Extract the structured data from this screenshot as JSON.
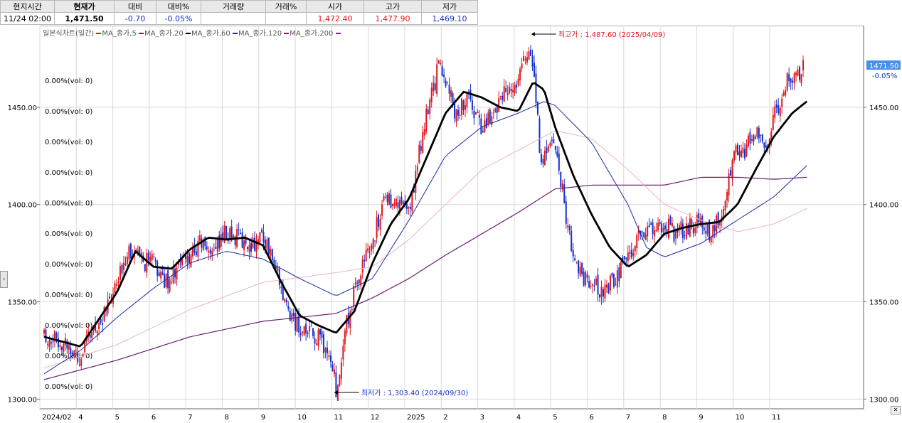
{
  "quote": {
    "headers": [
      "현지시간",
      "현재가",
      "대비",
      "대비%",
      "거래량",
      "거래%",
      "시가",
      "고가",
      "저가"
    ],
    "values": [
      "11/24  02:00",
      "1,471.50",
      "-0.70",
      "-0.05%",
      "",
      "",
      "1,472.40",
      "1,477.90",
      "1,469.10"
    ]
  },
  "chart_title": "일본식차트(일간)",
  "legend": [
    "MA_종가,5",
    "MA_종가,20",
    "MA_종가,60",
    "MA_종가,120",
    "MA_종가,200"
  ],
  "legend_colors": [
    "#e0161b",
    "#b01030",
    "#000000",
    "#1a2aa0",
    "#7a1f78"
  ],
  "current_price_box": {
    "value": "1471.50",
    "pct": "-0.05%"
  },
  "max_label": "최고가 : 1,487.60 (2025/04/09)",
  "min_label": "최저가 : 1,303.40 (2024/09/30)",
  "chart_data": {
    "type": "candlestick",
    "title": "일본식차트(일간)",
    "ylim": [
      1295,
      1492
    ],
    "y_ticks": [
      "1300.00",
      "1350.00",
      "1400.00",
      "1450.00"
    ],
    "y_tick_values": [
      1300,
      1350,
      1400,
      1450
    ],
    "x_labels": [
      "2024/02",
      "4",
      "5",
      "6",
      "7",
      "8",
      "9",
      "10",
      "11",
      "12",
      "2025",
      "2",
      "3",
      "4",
      "5",
      "6",
      "7",
      "8",
      "9",
      "10",
      "11"
    ],
    "volume_labels": [
      "0.00%(vol: 0)",
      "0.00%(vol: 0)",
      "0.00%(vol: 0)",
      "0.00%(vol: 0)",
      "0.00%(vol: 0)",
      "0.00%(vol: 0)",
      "0.00%(vol: 0)",
      "0.00%(vol: 0)",
      "0.00%(vol: 0)",
      "0.00%(vol: 0)",
      "0.00%(vol: 0)"
    ],
    "close_anchors": [
      [
        0,
        1333
      ],
      [
        0.5,
        1330
      ],
      [
        1,
        1321
      ],
      [
        1.3,
        1334
      ],
      [
        1.7,
        1345
      ],
      [
        2,
        1358
      ],
      [
        2.3,
        1379
      ],
      [
        2.6,
        1371
      ],
      [
        3,
        1370
      ],
      [
        3.3,
        1360
      ],
      [
        3.6,
        1366
      ],
      [
        4,
        1374
      ],
      [
        4.3,
        1380
      ],
      [
        4.6,
        1376
      ],
      [
        5,
        1386
      ],
      [
        5.3,
        1383
      ],
      [
        5.6,
        1379
      ],
      [
        6,
        1384
      ],
      [
        6.3,
        1372
      ],
      [
        6.6,
        1348
      ],
      [
        7,
        1336
      ],
      [
        7.3,
        1333
      ],
      [
        7.6,
        1330
      ],
      [
        7.9,
        1318
      ],
      [
        8,
        1305
      ],
      [
        8.3,
        1340
      ],
      [
        8.6,
        1362
      ],
      [
        8.9,
        1375
      ],
      [
        9.1,
        1388
      ],
      [
        9.4,
        1405
      ],
      [
        10,
        1395
      ],
      [
        10.3,
        1430
      ],
      [
        10.6,
        1455
      ],
      [
        10.8,
        1470
      ],
      [
        11,
        1465
      ],
      [
        11.3,
        1445
      ],
      [
        11.6,
        1455
      ],
      [
        12,
        1440
      ],
      [
        12.3,
        1447
      ],
      [
        12.6,
        1458
      ],
      [
        13,
        1466
      ],
      [
        13.3,
        1482
      ],
      [
        13.4,
        1470
      ],
      [
        13.6,
        1425
      ],
      [
        14,
        1430
      ],
      [
        14.3,
        1395
      ],
      [
        14.6,
        1365
      ],
      [
        15,
        1358
      ],
      [
        15.3,
        1356
      ],
      [
        15.6,
        1360
      ],
      [
        16,
        1372
      ],
      [
        16.3,
        1385
      ],
      [
        16.6,
        1388
      ],
      [
        17,
        1390
      ],
      [
        17.3,
        1385
      ],
      [
        17.6,
        1388
      ],
      [
        18,
        1392
      ],
      [
        18.3,
        1384
      ],
      [
        18.6,
        1400
      ],
      [
        18.9,
        1428
      ],
      [
        19.2,
        1426
      ],
      [
        19.5,
        1440
      ],
      [
        19.8,
        1430
      ],
      [
        20,
        1445
      ],
      [
        20.3,
        1462
      ],
      [
        20.6,
        1466
      ],
      [
        20.8,
        1471.5
      ]
    ],
    "ma60": [
      [
        0,
        1332
      ],
      [
        1,
        1327
      ],
      [
        2,
        1355
      ],
      [
        2.5,
        1376
      ],
      [
        3,
        1368
      ],
      [
        3.5,
        1367
      ],
      [
        4,
        1377
      ],
      [
        4.5,
        1383
      ],
      [
        5,
        1382
      ],
      [
        5.5,
        1383
      ],
      [
        6,
        1379
      ],
      [
        6.5,
        1360
      ],
      [
        7,
        1343
      ],
      [
        7.5,
        1338
      ],
      [
        8,
        1334
      ],
      [
        8.5,
        1345
      ],
      [
        9,
        1370
      ],
      [
        9.5,
        1390
      ],
      [
        10,
        1403
      ],
      [
        10.5,
        1425
      ],
      [
        11,
        1447
      ],
      [
        11.5,
        1458
      ],
      [
        12,
        1455
      ],
      [
        12.5,
        1450
      ],
      [
        13,
        1448
      ],
      [
        13.4,
        1463
      ],
      [
        13.7,
        1459
      ],
      [
        14,
        1440
      ],
      [
        14.5,
        1415
      ],
      [
        15,
        1395
      ],
      [
        15.5,
        1378
      ],
      [
        16,
        1368
      ],
      [
        16.5,
        1374
      ],
      [
        17,
        1385
      ],
      [
        17.5,
        1388
      ],
      [
        18,
        1390
      ],
      [
        18.5,
        1391
      ],
      [
        19,
        1400
      ],
      [
        19.5,
        1418
      ],
      [
        20,
        1435
      ],
      [
        20.5,
        1447
      ],
      [
        20.9,
        1453
      ]
    ],
    "ma120": [
      [
        0,
        1313
      ],
      [
        1,
        1325
      ],
      [
        2,
        1342
      ],
      [
        3,
        1357
      ],
      [
        4,
        1370
      ],
      [
        5,
        1376
      ],
      [
        6,
        1372
      ],
      [
        7,
        1362
      ],
      [
        8,
        1353
      ],
      [
        9,
        1362
      ],
      [
        10,
        1392
      ],
      [
        11,
        1425
      ],
      [
        12,
        1440
      ],
      [
        13,
        1447
      ],
      [
        13.7,
        1453
      ],
      [
        14,
        1451
      ],
      [
        15,
        1432
      ],
      [
        16,
        1400
      ],
      [
        16.5,
        1378
      ],
      [
        17,
        1373
      ],
      [
        18,
        1380
      ],
      [
        19,
        1392
      ],
      [
        20,
        1404
      ],
      [
        20.9,
        1420
      ]
    ],
    "ma200": [
      [
        0,
        1316
      ],
      [
        2,
        1328
      ],
      [
        4,
        1346
      ],
      [
        6,
        1360
      ],
      [
        8,
        1365
      ],
      [
        9,
        1368
      ],
      [
        10,
        1382
      ],
      [
        11,
        1400
      ],
      [
        12,
        1418
      ],
      [
        13,
        1428
      ],
      [
        14,
        1438
      ],
      [
        15,
        1434
      ],
      [
        16,
        1418
      ],
      [
        17,
        1400
      ],
      [
        18,
        1392
      ],
      [
        19,
        1386
      ],
      [
        20,
        1390
      ],
      [
        20.9,
        1398
      ]
    ],
    "ma_purple": [
      [
        0,
        1310
      ],
      [
        2,
        1320
      ],
      [
        4,
        1332
      ],
      [
        6,
        1340
      ],
      [
        8,
        1344
      ],
      [
        9,
        1352
      ],
      [
        10,
        1362
      ],
      [
        11,
        1374
      ],
      [
        12,
        1385
      ],
      [
        13,
        1396
      ],
      [
        14,
        1408
      ],
      [
        15,
        1410
      ],
      [
        16,
        1410
      ],
      [
        17,
        1410
      ],
      [
        18,
        1414
      ],
      [
        19,
        1414
      ],
      [
        20,
        1413
      ],
      [
        20.9,
        1414
      ]
    ]
  }
}
